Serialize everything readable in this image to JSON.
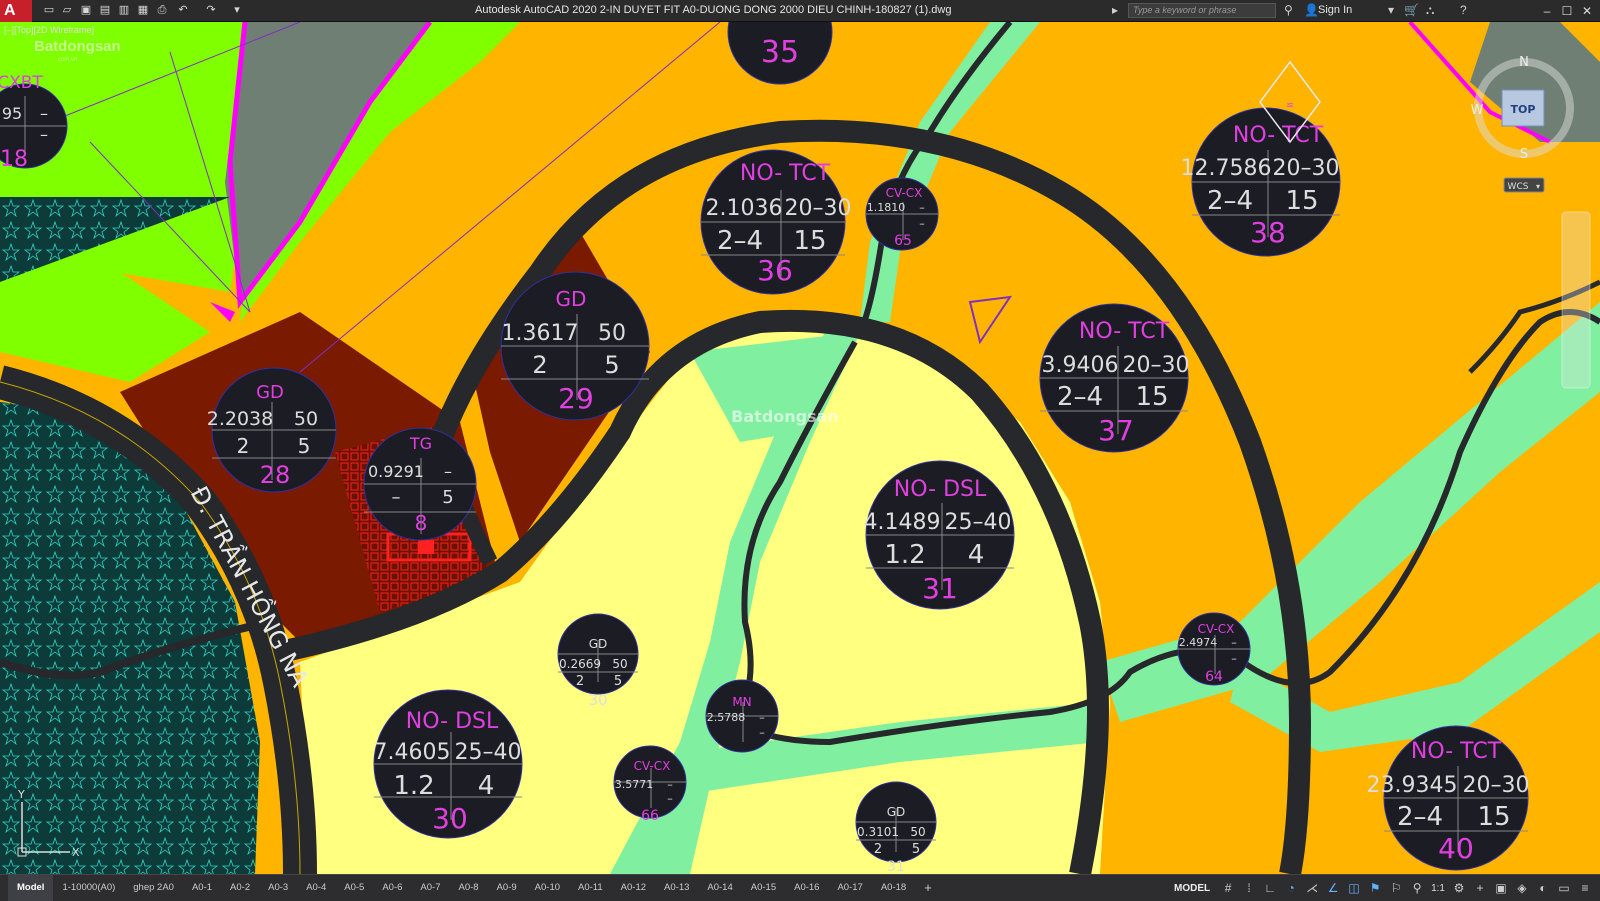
{
  "app": {
    "title": "Autodesk AutoCAD 2020   2-IN DUYET FIT A0-DUONG DONG 2000 DIEU CHINH-180827 (1).dwg",
    "logo_letter": "A",
    "search_placeholder": "Type a keyword or phrase",
    "signin_label": "Sign In",
    "quick_access_icons": [
      "new-icon",
      "open-icon",
      "save-icon",
      "saveas-icon",
      "plot-preview-icon",
      "publish-icon",
      "print-icon",
      "undo-icon",
      "redo-icon",
      "customize-icon"
    ]
  },
  "viewport": {
    "label": "[–][Top][2D Wireframe]",
    "watermark": "Batdongsan",
    "watermark_sub": "com.vn",
    "center_watermark": "Batdongsan",
    "street_label": "Đ. TRẦN HỒNG NA",
    "viewcube": {
      "north": "N",
      "west": "W",
      "south": "S",
      "top": "TOP",
      "wcs": "WCS"
    },
    "ucs": {
      "x": "X",
      "y": "Y"
    }
  },
  "parcels": [
    {
      "code": "CXBT",
      "area": "95",
      "f": "–",
      "h": "–",
      "number": "18"
    },
    {
      "code": "",
      "area": "",
      "f": "",
      "h": "",
      "number": "35"
    },
    {
      "code": "NO- TCT",
      "area": "2.1036",
      "f": "20–30",
      "h": "2–4",
      "d": "15",
      "number": "36"
    },
    {
      "code": "CV-CX",
      "area": "1.1810",
      "f": "–",
      "h": "–",
      "number": "65"
    },
    {
      "code": "NO- TCT",
      "area": "12.7586",
      "f": "20–30",
      "h": "2–4",
      "d": "15",
      "number": "38"
    },
    {
      "code": "GD",
      "area": "1.3617",
      "f": "50",
      "h": "2",
      "d": "5",
      "number": "29"
    },
    {
      "code": "GD",
      "area": "2.2038",
      "f": "50",
      "h": "2",
      "d": "5",
      "number": "28"
    },
    {
      "code": "TG",
      "area": "0.9291",
      "f": "–",
      "h": "–",
      "d": "5",
      "number": "8"
    },
    {
      "code": "NO- TCT",
      "area": "3.9406",
      "f": "20–30",
      "h": "2–4",
      "d": "15",
      "number": "37"
    },
    {
      "code": "NO- DSL",
      "area": "4.1489",
      "f": "25–40",
      "h": "1.2",
      "d": "4",
      "number": "31"
    },
    {
      "code": "CV-CX",
      "area": "2.4974",
      "f": "–",
      "h": "–",
      "number": "64"
    },
    {
      "code": "GD",
      "area": "0.2669",
      "f": "50",
      "h": "2",
      "d": "5",
      "number": "30"
    },
    {
      "code": "MN",
      "area": "2.5788",
      "f": "–",
      "h": "–",
      "number": ""
    },
    {
      "code": "NO- DSL",
      "area": "7.4605",
      "f": "25–40",
      "h": "1.2",
      "d": "4",
      "number": "30"
    },
    {
      "code": "CV-CX",
      "area": "3.5771",
      "f": "–",
      "h": "–",
      "number": "66"
    },
    {
      "code": "GD",
      "area": "0.3101",
      "f": "50",
      "h": "2",
      "d": "5",
      "number": "31"
    },
    {
      "code": "NO- TCT",
      "area": "23.9345",
      "f": "20–30",
      "h": "2–4",
      "d": "15",
      "number": "40"
    }
  ],
  "layout_tabs": [
    "Model",
    "1-10000(A0)",
    "ghep 2A0",
    "A0-1",
    "A0-2",
    "A0-3",
    "A0-4",
    "A0-5",
    "A0-6",
    "A0-7",
    "A0-8",
    "A0-9",
    "A0-10",
    "A0-11",
    "A0-12",
    "A0-13",
    "A0-14",
    "A0-15",
    "A0-16",
    "A0-17",
    "A0-18",
    "+"
  ],
  "status": {
    "model": "MODEL",
    "scale": "1:1"
  },
  "colors": {
    "residential": "#ffb400",
    "green": "#80ff00",
    "park": "#80f0a0",
    "school": "#7a1a00",
    "low_density": "#ffff80",
    "road": "#26282b",
    "label_magenta": "#e040e0",
    "label_bubble": "#1c1c24"
  }
}
